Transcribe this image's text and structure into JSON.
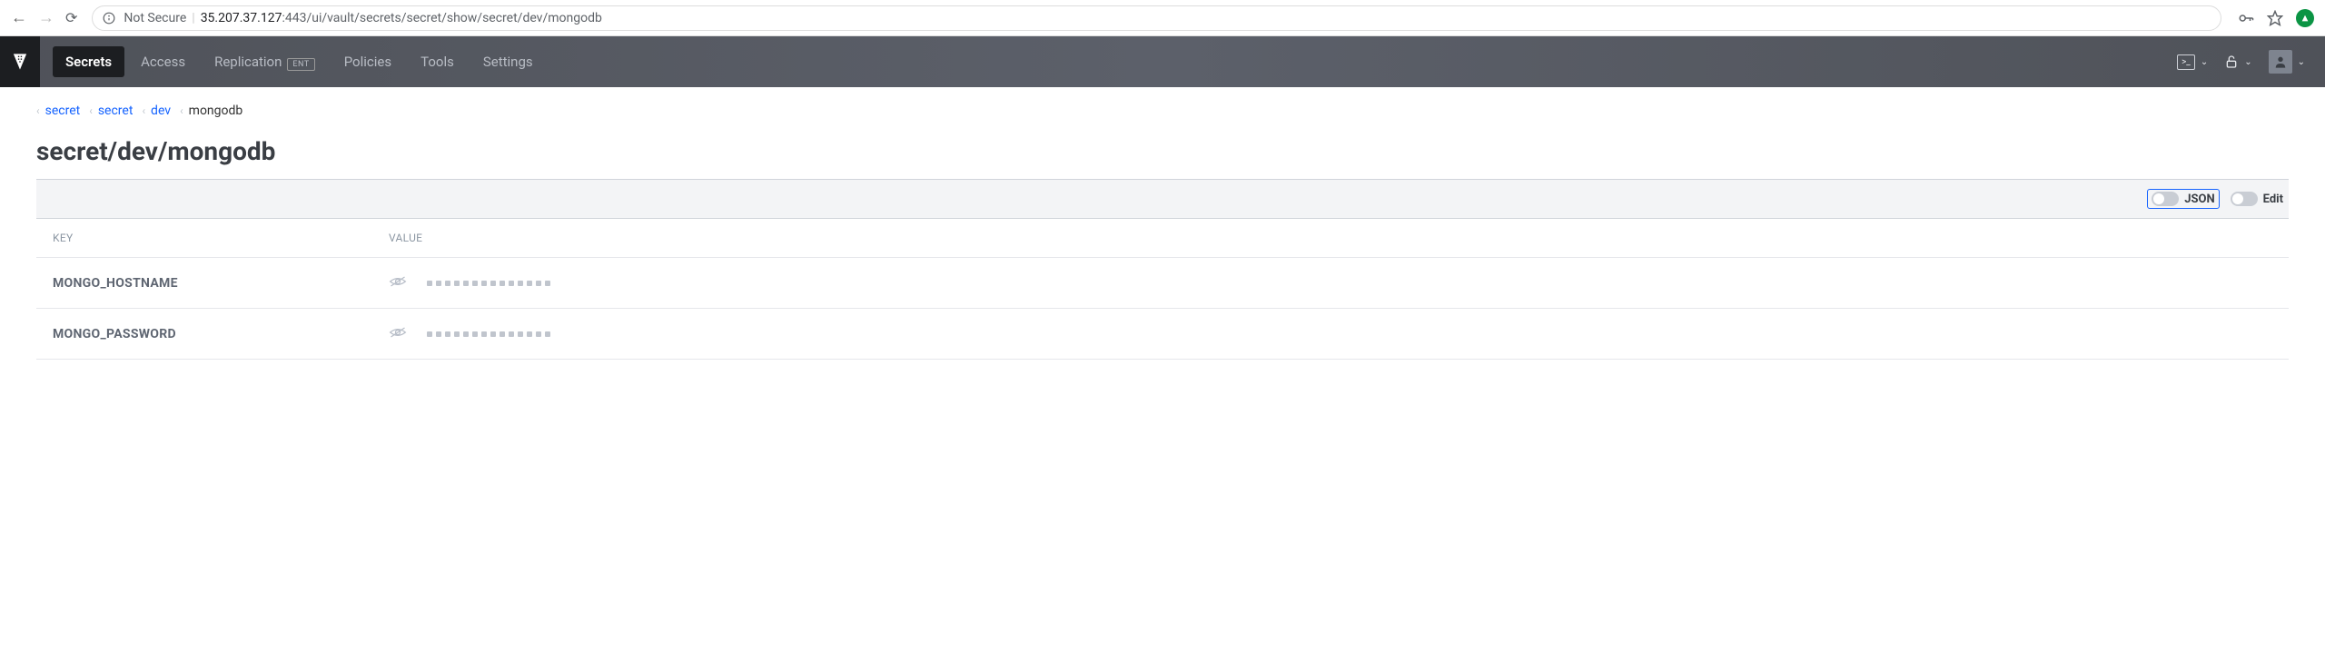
{
  "browser": {
    "security": "Not Secure",
    "url_host": "35.207.37.127",
    "url_path": ":443/ui/vault/secrets/secret/show/secret/dev/mongodb"
  },
  "nav": {
    "items": [
      {
        "label": "Secrets",
        "active": true
      },
      {
        "label": "Access",
        "active": false
      },
      {
        "label": "Replication",
        "badge": "ENT",
        "active": false
      },
      {
        "label": "Policies",
        "active": false
      },
      {
        "label": "Tools",
        "active": false
      },
      {
        "label": "Settings",
        "active": false
      }
    ]
  },
  "breadcrumb": [
    {
      "label": "secret",
      "link": true
    },
    {
      "label": "secret",
      "link": true
    },
    {
      "label": "dev",
      "link": true
    },
    {
      "label": "mongodb",
      "link": false
    }
  ],
  "page_title": "secret/dev/mongodb",
  "toolbar": {
    "json_label": "JSON",
    "edit_label": "Edit"
  },
  "table": {
    "headers": {
      "key": "KEY",
      "value": "VALUE"
    },
    "rows": [
      {
        "key": "MONGO_HOSTNAME",
        "masked_dots": 14
      },
      {
        "key": "MONGO_PASSWORD",
        "masked_dots": 14
      }
    ]
  }
}
